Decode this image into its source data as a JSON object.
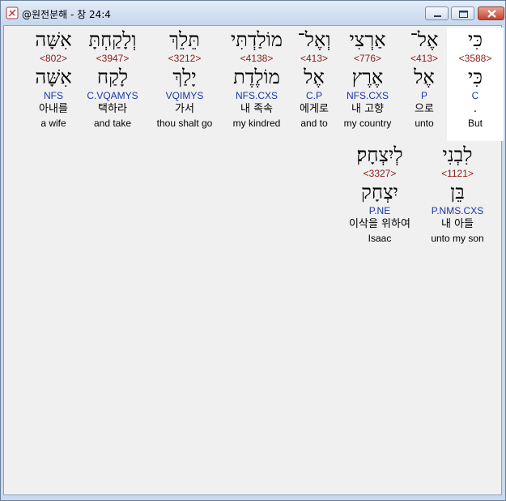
{
  "window": {
    "title": "@원전분해 - 창 24:4"
  },
  "words": [
    {
      "heb": "כִּי",
      "strong": "<3588>",
      "lemma": "כִּי",
      "parse": "C",
      "kor": ".",
      "eng": "But"
    },
    {
      "heb": "אֶל־",
      "strong": "<413>",
      "lemma": "אֶל",
      "parse": "P",
      "kor": "으로",
      "eng": "unto"
    },
    {
      "heb": "אַרְצִי",
      "strong": "<776>",
      "lemma": "אֶרֶץ",
      "parse": "NFS.CXS",
      "kor": "내 고향",
      "eng": "my country"
    },
    {
      "heb": "וְאֶל־",
      "strong": "<413>",
      "lemma": "אֶל",
      "parse": "C.P",
      "kor": "에게로",
      "eng": "and to"
    },
    {
      "heb": "מוֹלַדְתִּי",
      "strong": "<4138>",
      "lemma": "מוֹלֶדֶת",
      "parse": "NFS.CXS",
      "kor": "내 족속",
      "eng": "my kindred"
    },
    {
      "heb": "תֵּלֵךְ",
      "strong": "<3212>",
      "lemma": "יָלַךְ",
      "parse": "VQIMYS",
      "kor": "가서",
      "eng": "thou shalt go"
    },
    {
      "heb": "וְלָקַחְתָּ",
      "strong": "<3947>",
      "lemma": "לָקַח",
      "parse": "C.VQAMYS",
      "kor": "택하라",
      "eng": "and take"
    },
    {
      "heb": "אִשָּׁה",
      "strong": "<802>",
      "lemma": "אִשָּׁה",
      "parse": "NFS",
      "kor": "아내를",
      "eng": "a wife"
    },
    {
      "heb": "לִבְנִי",
      "strong": "<1121>",
      "lemma": "בֵּן",
      "parse": "P.NMS.CXS",
      "kor": "내 아들",
      "eng": "unto my son"
    },
    {
      "heb": "לְיִצְחָק׃",
      "strong": "<3327>",
      "lemma": "יִצְחָק",
      "parse": "P.NE",
      "kor": "이삭을 위하여",
      "eng": "Isaac"
    }
  ]
}
